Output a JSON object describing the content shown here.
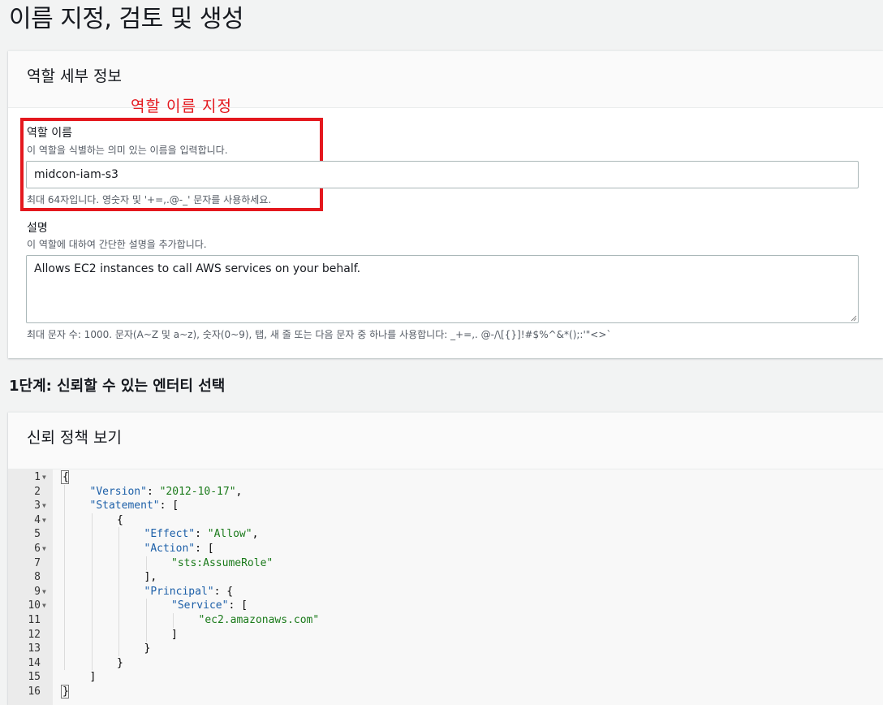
{
  "page": {
    "title": "이름 지정, 검토 및 생성"
  },
  "role_details": {
    "header": "역할 세부 정보",
    "annotation": "역할 이름 지정",
    "role_name": {
      "label": "역할 이름",
      "description": "이 역할을 식별하는 의미 있는 이름을 입력합니다.",
      "value": "midcon-iam-s3",
      "constraint": "최대 64자입니다. 영숫자 및 '+=,.@-_' 문자를 사용하세요."
    },
    "description_field": {
      "label": "설명",
      "description": "이 역할에 대하여 간단한 설명을 추가합니다.",
      "value": "Allows EC2 instances to call AWS services on your behalf.",
      "constraint": "최대 문자 수: 1000. 문자(A~Z 및 a~z), 숫자(0~9), 탭, 새 줄 또는 다음 문자 중 하나를 사용합니다: _+=,. @-/\\[{}]!#$%^&*();:'\"<>`"
    }
  },
  "step1": {
    "heading": "1단계: 신뢰할 수 있는 엔터티 선택"
  },
  "trust_policy": {
    "header": "신뢰 정책 보기",
    "lines": [
      {
        "n": "1",
        "fold": true,
        "indent": 0,
        "parts": [
          [
            "p",
            "{"
          ]
        ]
      },
      {
        "n": "2",
        "fold": false,
        "indent": 1,
        "parts": [
          [
            "k",
            "\"Version\""
          ],
          [
            "p",
            ": "
          ],
          [
            "s",
            "\"2012-10-17\""
          ],
          [
            "p",
            ","
          ]
        ]
      },
      {
        "n": "3",
        "fold": true,
        "indent": 1,
        "parts": [
          [
            "k",
            "\"Statement\""
          ],
          [
            "p",
            ": ["
          ]
        ]
      },
      {
        "n": "4",
        "fold": true,
        "indent": 2,
        "parts": [
          [
            "p",
            "{"
          ]
        ]
      },
      {
        "n": "5",
        "fold": false,
        "indent": 3,
        "parts": [
          [
            "k",
            "\"Effect\""
          ],
          [
            "p",
            ": "
          ],
          [
            "s",
            "\"Allow\""
          ],
          [
            "p",
            ","
          ]
        ]
      },
      {
        "n": "6",
        "fold": true,
        "indent": 3,
        "parts": [
          [
            "k",
            "\"Action\""
          ],
          [
            "p",
            ": ["
          ]
        ]
      },
      {
        "n": "7",
        "fold": false,
        "indent": 4,
        "parts": [
          [
            "s",
            "\"sts:AssumeRole\""
          ]
        ]
      },
      {
        "n": "8",
        "fold": false,
        "indent": 3,
        "parts": [
          [
            "p",
            "],"
          ]
        ]
      },
      {
        "n": "9",
        "fold": true,
        "indent": 3,
        "parts": [
          [
            "k",
            "\"Principal\""
          ],
          [
            "p",
            ": {"
          ]
        ]
      },
      {
        "n": "10",
        "fold": true,
        "indent": 4,
        "parts": [
          [
            "k",
            "\"Service\""
          ],
          [
            "p",
            ": ["
          ]
        ]
      },
      {
        "n": "11",
        "fold": false,
        "indent": 5,
        "parts": [
          [
            "s",
            "\"ec2.amazonaws.com\""
          ]
        ]
      },
      {
        "n": "12",
        "fold": false,
        "indent": 4,
        "parts": [
          [
            "p",
            "]"
          ]
        ]
      },
      {
        "n": "13",
        "fold": false,
        "indent": 3,
        "parts": [
          [
            "p",
            "}"
          ]
        ]
      },
      {
        "n": "14",
        "fold": false,
        "indent": 2,
        "parts": [
          [
            "p",
            "}"
          ]
        ]
      },
      {
        "n": "15",
        "fold": false,
        "indent": 1,
        "parts": [
          [
            "p",
            "]"
          ]
        ]
      },
      {
        "n": "16",
        "fold": false,
        "indent": 0,
        "parts": [
          [
            "p",
            "}"
          ]
        ]
      }
    ]
  }
}
